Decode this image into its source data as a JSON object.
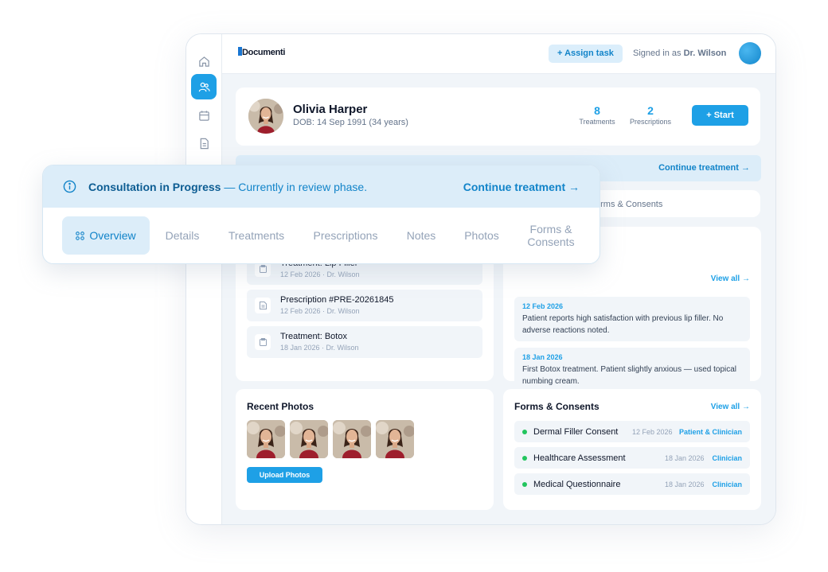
{
  "topbar": {
    "logo": "Documenti",
    "assign_label": "+ Assign task",
    "signed_prefix": "Signed in as",
    "signed_user": "Dr. Wilson"
  },
  "sidebar": {
    "items": [
      "home-icon",
      "users-icon",
      "calendar-icon",
      "document-icon"
    ],
    "active_index": 1
  },
  "patient": {
    "name": "Olivia Harper",
    "dob": "DOB: 14 Sep 1991 (34 years)",
    "stats": [
      {
        "value": "8",
        "label": "Treatments"
      },
      {
        "value": "2",
        "label": "Prescriptions"
      }
    ],
    "start_label": "+ Start"
  },
  "banner": {
    "title": "Consultation in Progress",
    "subtitle": "— Currently in review phase.",
    "continue": "Continue treatment →"
  },
  "tabs": {
    "items": [
      "Overview",
      "Details",
      "Treatments",
      "Prescriptions",
      "Notes",
      "Photos",
      "Forms & Consents"
    ],
    "active": "Overview",
    "bg_partial": "orms & Consents"
  },
  "timeline": {
    "items": [
      {
        "title": "Treatment: Lip Filler",
        "meta": "12 Feb 2026 · Dr. Wilson"
      },
      {
        "title": "Prescription #PRE-20261845",
        "meta": "12 Feb 2026 · Dr. Wilson"
      },
      {
        "title": "Treatment: Botox",
        "meta": "18 Jan 2026 · Dr. Wilson"
      }
    ]
  },
  "notes": {
    "view_all": "View all →",
    "items": [
      {
        "date": "12 Feb 2026",
        "text": "Patient reports high satisfaction with previous lip filler. No adverse reactions noted."
      },
      {
        "date": "18 Jan 2026",
        "text": "First Botox treatment. Patient slightly anxious — used topical numbing cream."
      }
    ]
  },
  "photos": {
    "title": "Recent Photos",
    "upload_label": "Upload Photos",
    "count": 4
  },
  "forms": {
    "title": "Forms & Consents",
    "view_all": "View all →",
    "items": [
      {
        "name": "Dermal Filler Consent",
        "date": "12 Feb 2026",
        "who": "Patient & Clinician"
      },
      {
        "name": "Healthcare Assessment",
        "date": "18 Jan 2026",
        "who": "Clinician"
      },
      {
        "name": "Medical Questionnaire",
        "date": "18 Jan 2026",
        "who": "Clinician"
      }
    ]
  },
  "colors": {
    "accent": "#1ea0e6",
    "accent_dark": "#1284c9",
    "banner_bg": "#dcedf9",
    "status_green": "#22c55e"
  }
}
